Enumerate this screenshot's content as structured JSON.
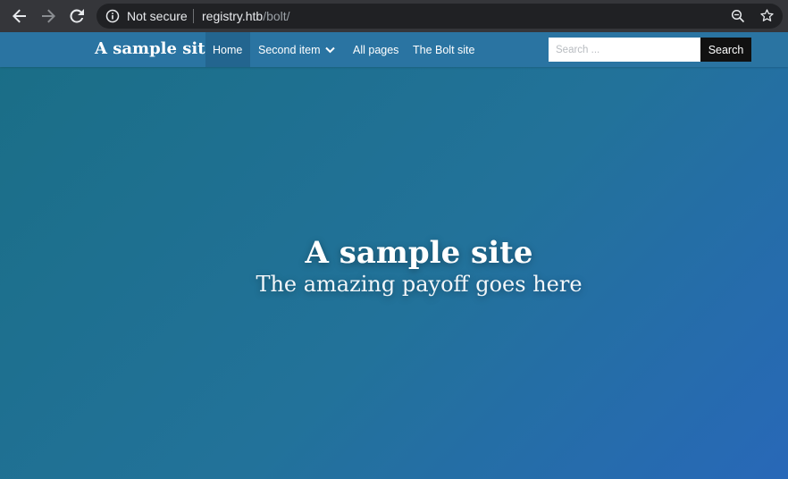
{
  "browser": {
    "security_label": "Not secure",
    "url_host": "registry.htb",
    "url_path": "/bolt/",
    "icons": [
      "back-arrow-icon",
      "forward-arrow-icon",
      "reload-icon",
      "info-icon",
      "zoom-icon",
      "star-icon"
    ]
  },
  "site": {
    "brand": "A sample site",
    "menu": [
      {
        "label": "Home",
        "active": true
      },
      {
        "label": "Second item",
        "has_dropdown": true
      },
      {
        "label": "All pages"
      },
      {
        "label": "The Bolt site"
      }
    ],
    "search": {
      "placeholder": "Search ...",
      "button_label": "Search"
    },
    "hero": {
      "title": "A sample site",
      "subtitle": "The amazing payoff goes here"
    },
    "colors": {
      "navbar": "#2a74a2",
      "gradient_start": "#1a6e86",
      "gradient_end": "#2868b8",
      "search_button": "#111111"
    }
  }
}
